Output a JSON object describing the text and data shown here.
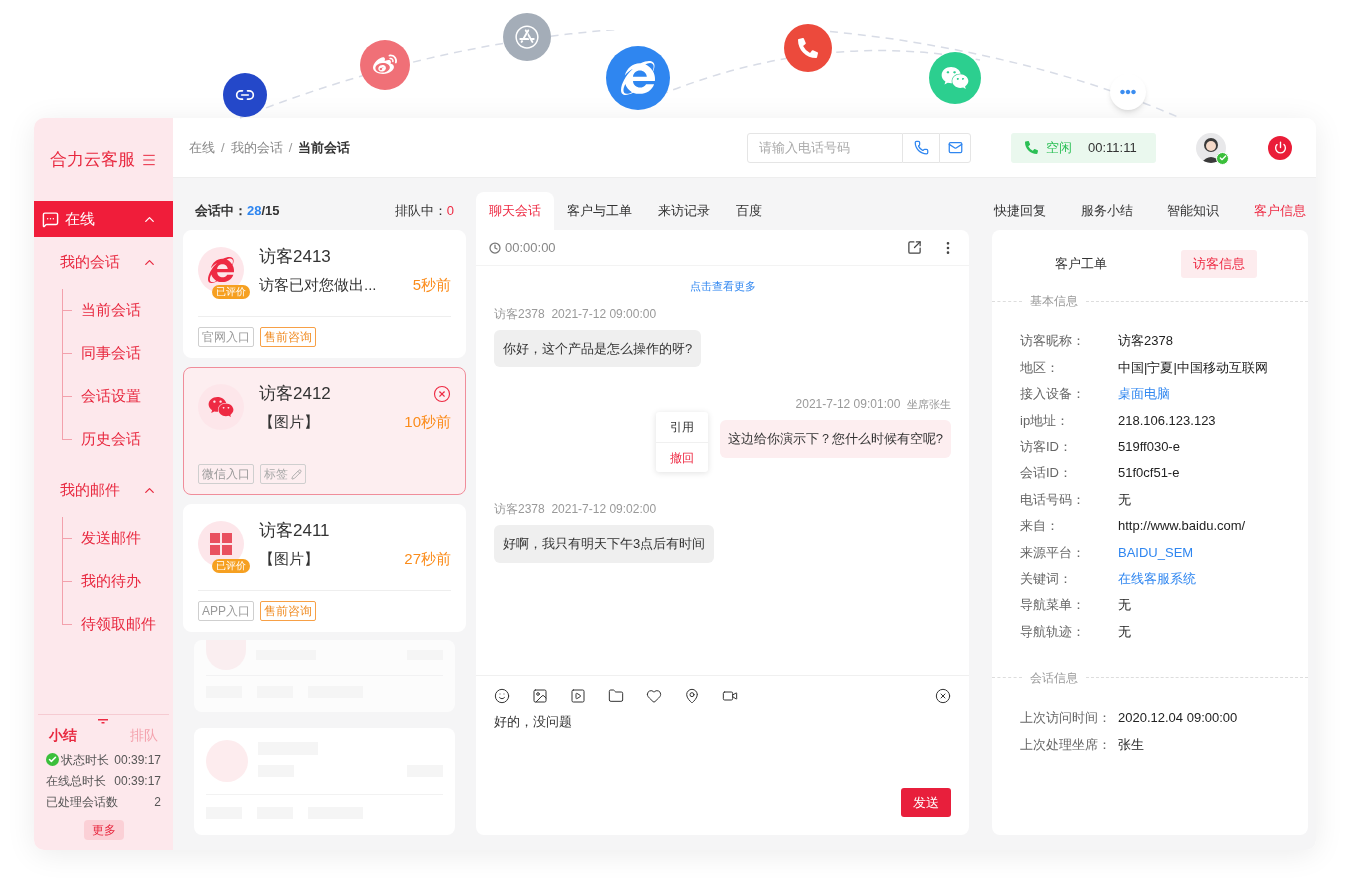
{
  "sidebar": {
    "brand": "合力云客服",
    "menu": [
      {
        "label": "在线",
        "expanded": true,
        "children": [
          {
            "label": "我的会话",
            "expanded": true,
            "children": [
              {
                "label": "当前会话"
              },
              {
                "label": "同事会话"
              },
              {
                "label": "会话设置"
              },
              {
                "label": "历史会话"
              }
            ]
          },
          {
            "label": "我的邮件",
            "expanded": true,
            "children": [
              {
                "label": "发送邮件"
              },
              {
                "label": "我的待办"
              },
              {
                "label": "待领取邮件"
              }
            ]
          }
        ]
      }
    ],
    "summary_tabs": [
      {
        "label": "小结",
        "selected": true
      },
      {
        "label": "排队",
        "selected": false
      }
    ],
    "stats": [
      {
        "kind": "status",
        "label": "状态时长",
        "value": "00:39:17"
      },
      {
        "kind": "plain",
        "label": "在线总时长",
        "value": "00:39:17"
      },
      {
        "kind": "plain",
        "label": "已处理会话数",
        "value": "2"
      }
    ],
    "more_button": "更多"
  },
  "header": {
    "breadcrumb": [
      "在线",
      "我的会话",
      "当前会话"
    ],
    "separator": "/",
    "phone_placeholder": "请输入电话号码",
    "status": {
      "label": "空闲",
      "time": "00:11:11"
    },
    "agent_online": true
  },
  "conversation_list": {
    "active_label": "会话中：",
    "active": "28",
    "total": "/15",
    "queue_label": "排队中：",
    "queue": "0",
    "items": [
      {
        "kind": "browser",
        "name": "访客2413",
        "preview": "访客已对您做出...",
        "time": "5秒前",
        "badge": "已评价",
        "selected": false,
        "tags": [
          {
            "label": "官网入口",
            "kind": "channel"
          },
          {
            "label": "售前咨询",
            "kind": "category"
          }
        ]
      },
      {
        "kind": "wechat",
        "name": "访客2412",
        "preview": "【图片】",
        "time": "10秒前",
        "selected": true,
        "tags": [
          {
            "label": "微信入口",
            "kind": "channel"
          },
          {
            "label": "标签",
            "kind": "editable"
          }
        ]
      },
      {
        "kind": "app",
        "name": "访客2411",
        "preview": "【图片】",
        "time": "27秒前",
        "badge": "已评价",
        "selected": false,
        "tags": [
          {
            "label": "APP入口",
            "kind": "channel"
          },
          {
            "label": "售前咨询",
            "kind": "category"
          }
        ]
      }
    ],
    "skeletons": [
      {
        "kind": "partial"
      },
      {
        "kind": "full"
      }
    ]
  },
  "chat": {
    "tabs": [
      {
        "label": "聊天会话",
        "selected": true
      },
      {
        "label": "客户与工单",
        "selected": false
      },
      {
        "label": "来访记录",
        "selected": false
      },
      {
        "label": "百度",
        "selected": false
      }
    ],
    "timer": "00:00:00",
    "load_more": "点击查看更多",
    "messages": [
      {
        "kind": "visitor",
        "sender": "访客2378",
        "time": "2021-7-12 09:00:00",
        "text": "你好，这个产品是怎么操作的呀?"
      },
      {
        "kind": "agent",
        "sender": "坐席张生",
        "time": "2021-7-12 09:01:00",
        "text": "这边给你演示下？您什么时候有空呢?",
        "menu": [
          {
            "label": "引用",
            "kind": "normal"
          },
          {
            "label": "撤回",
            "kind": "danger"
          }
        ]
      },
      {
        "kind": "visitor",
        "sender": "访客2378",
        "time": "2021-7-12 09:02:00",
        "text": "好啊，我只有明天下午3点后有时间"
      }
    ],
    "input": "好的，没问题",
    "send": "发送"
  },
  "info": {
    "tabs": [
      {
        "label": "快捷回复",
        "selected": false
      },
      {
        "label": "服务小结",
        "selected": false
      },
      {
        "label": "智能知识",
        "selected": false
      },
      {
        "label": "客户信息",
        "selected": true
      }
    ],
    "subtabs": [
      {
        "label": "客户工单",
        "selected": false
      },
      {
        "label": "访客信息",
        "selected": true
      }
    ],
    "sections": [
      {
        "title": "基本信息",
        "fields": [
          {
            "label": "访客昵称：",
            "value": "访客2378",
            "link": false
          },
          {
            "label": "地区：",
            "value": "中国|宁夏|中国移动互联网",
            "link": false
          },
          {
            "label": "接入设备：",
            "value": "桌面电脑",
            "link": true
          },
          {
            "label": "ip地址：",
            "value": "218.106.123.123",
            "link": false
          },
          {
            "label": "访客ID：",
            "value": "519ff030-e",
            "link": false
          },
          {
            "label": "会话ID：",
            "value": "51f0cf51-e",
            "link": false
          },
          {
            "label": "电话号码：",
            "value": "无",
            "link": false
          },
          {
            "label": "来自：",
            "value": "http://www.baidu.com/",
            "link": false
          },
          {
            "label": "来源平台：",
            "value": "BAIDU_SEM",
            "link": true
          },
          {
            "label": "关键词：",
            "value": "在线客服系统",
            "link": true
          },
          {
            "label": "导航菜单：",
            "value": "无",
            "link": false
          },
          {
            "label": "导航轨迹：",
            "value": "无",
            "link": false
          }
        ]
      },
      {
        "title": "会话信息",
        "fields": [
          {
            "label": "上次访问时间：",
            "value": "2020.12.04 09:00:00",
            "link": false
          },
          {
            "label": "上次处理坐席：",
            "value": "张生",
            "link": false
          }
        ]
      }
    ]
  }
}
